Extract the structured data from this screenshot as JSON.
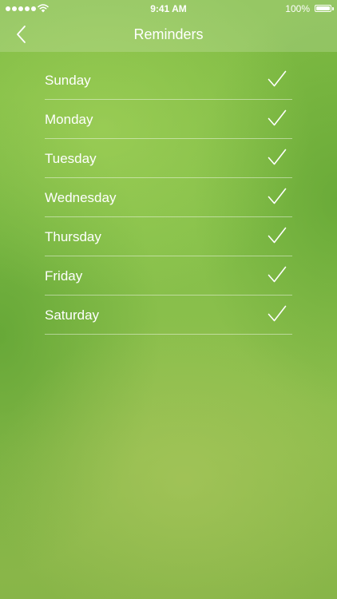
{
  "status_bar": {
    "time": "9:41 AM",
    "battery": "100%",
    "signal_icon": "signal-dots-icon",
    "wifi_icon": "wifi-icon",
    "battery_icon": "battery-icon"
  },
  "nav": {
    "title": "Reminders",
    "back_icon": "chevron-left-icon"
  },
  "days": [
    {
      "label": "Sunday",
      "checked": true
    },
    {
      "label": "Monday",
      "checked": true
    },
    {
      "label": "Tuesday",
      "checked": true
    },
    {
      "label": "Wednesday",
      "checked": true
    },
    {
      "label": "Thursday",
      "checked": true
    },
    {
      "label": "Friday",
      "checked": true
    },
    {
      "label": "Saturday",
      "checked": true
    }
  ],
  "colors": {
    "background": "#86c04a",
    "text": "#ffffff"
  }
}
